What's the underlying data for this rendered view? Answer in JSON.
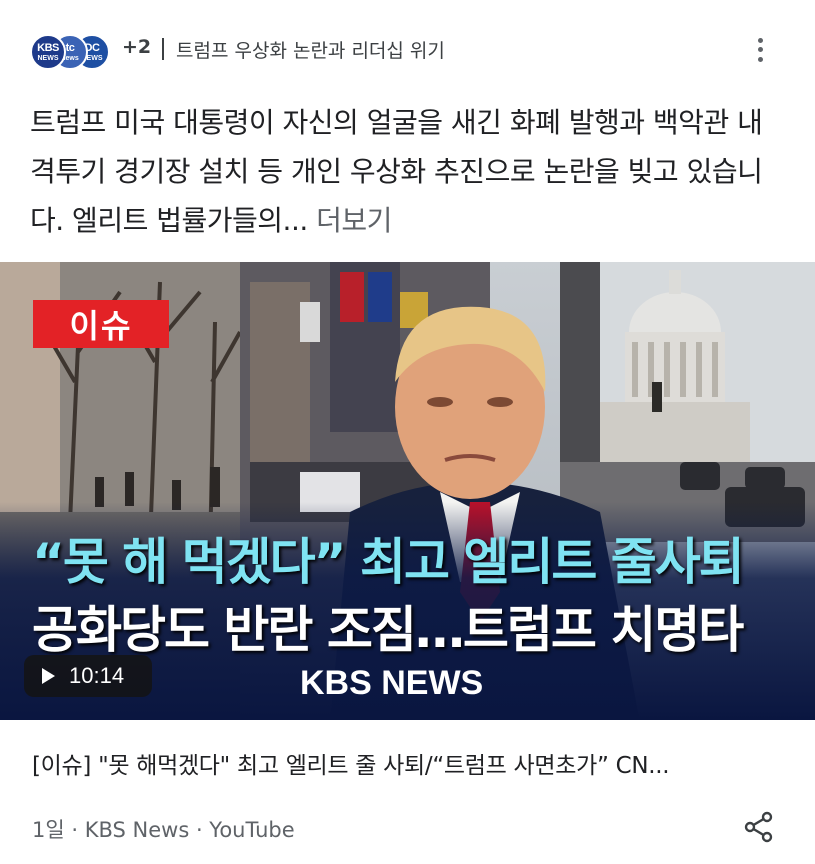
{
  "header": {
    "logos": [
      {
        "line1": "KBS",
        "line2": "NEWS"
      },
      {
        "line1": "tc",
        "line2": "news"
      },
      {
        "line1": "DC",
        "line2": "NEWS"
      }
    ],
    "extra_count": "+2",
    "topic": "트럼프 우상화 논란과 리더십 위기",
    "menu_icon": "more-vert-icon"
  },
  "description": {
    "text": "트럼프 미국 대통령이 자신의 얼굴을 새긴 화폐 발행과 백악관 내 격투기 경기장 설치 등 개인 우상화 추진으로 논란을 빚고 있습니다. 엘리트 법률가들의...",
    "more": "더보기"
  },
  "thumbnail": {
    "issue_tag": "이슈",
    "headline_line1": "“못 해 먹겠다” 최고 엘리트 줄사퇴",
    "headline_line2": "공화당도 반란 조짐…트럼프 치명타",
    "watermark": "KBS NEWS",
    "duration": "10:14",
    "colors": {
      "tag": "#e32226",
      "headline_accent": "#7fe3f2",
      "banner": "#0f1f52"
    }
  },
  "video": {
    "title": "[이슈] \"못 해먹겠다\" 최고 엘리트 줄 사퇴/“트럼프 사면초가” CN...",
    "meta": "1일 · KBS News · YouTube",
    "share_icon": "share-icon"
  }
}
